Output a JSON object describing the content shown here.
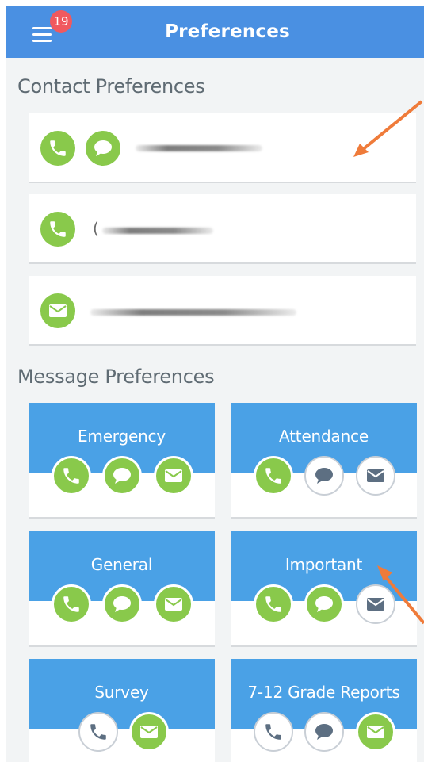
{
  "header": {
    "title": "Preferences",
    "notification_count": "19"
  },
  "contact_section": {
    "title": "Contact Preferences",
    "items": [
      {
        "icons": [
          "phone-icon",
          "chat-icon"
        ],
        "value": ""
      },
      {
        "icons": [
          "phone-icon"
        ],
        "value": "("
      },
      {
        "icons": [
          "email-icon"
        ],
        "value": ""
      }
    ]
  },
  "message_section": {
    "title": "Message Preferences",
    "tiles": [
      {
        "label": "Emergency",
        "phone": true,
        "text": true,
        "email": true
      },
      {
        "label": "Attendance",
        "phone": true,
        "text": false,
        "email": false
      },
      {
        "label": "General",
        "phone": true,
        "text": true,
        "email": true
      },
      {
        "label": "Important",
        "phone": true,
        "text": true,
        "email": false
      },
      {
        "label": "Survey",
        "phone": false,
        "email": true
      },
      {
        "label": "7-12 Grade Reports",
        "phone": false,
        "text": false,
        "email": true
      }
    ]
  },
  "colors": {
    "header": "#4a90e2",
    "tile": "#4aa1e6",
    "active_icon": "#89c94b",
    "inactive_icon_border": "#c9cfd6",
    "badge": "#f0595f",
    "annotation_arrow": "#ef7b3a"
  }
}
